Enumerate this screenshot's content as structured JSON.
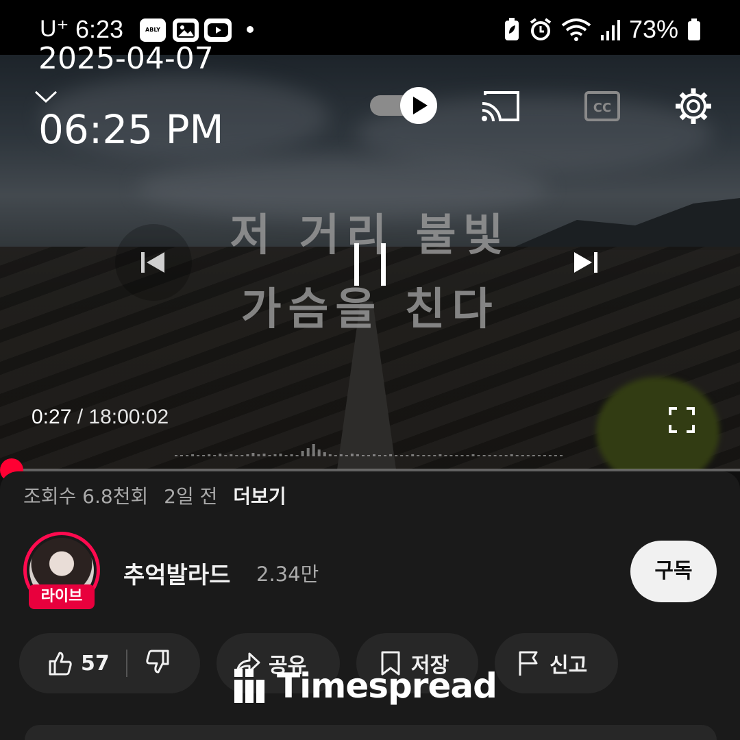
{
  "status_bar": {
    "carrier": "U⁺",
    "time": "6:23",
    "app_badge": "ABLY",
    "battery_percent": "73%",
    "icons": [
      "ably-app-icon",
      "gallery-icon",
      "youtube-icon",
      "notification-dot",
      "battery-saver-icon",
      "alarm-icon",
      "wifi-icon",
      "signal-icon",
      "battery-icon"
    ]
  },
  "overlay": {
    "date": "2025-04-07",
    "time": "06:25 PM"
  },
  "player": {
    "title_line1": "저 거리 불빛",
    "title_line2": "가슴을 친다",
    "current_time": "0:27",
    "separator": "/",
    "total_time": "18:00:02",
    "progress": 0.0004,
    "autoplay_on": true
  },
  "video_meta": {
    "views": "조회수 6.8천회",
    "age": "2일 전",
    "more": "더보기"
  },
  "channel": {
    "name": "추억발라드",
    "subscribers": "2.34만",
    "live_badge": "라이브",
    "subscribe_label": "구독"
  },
  "actions": {
    "like_count": "57",
    "share_label": "공유",
    "save_label": "저장",
    "report_label": "신고"
  },
  "watermark": {
    "text": "Timespread"
  },
  "colors": {
    "accent_red": "#ff0000",
    "live_red": "#e8003d",
    "panel_bg": "#1a1a1a",
    "pill_bg": "#272727"
  }
}
